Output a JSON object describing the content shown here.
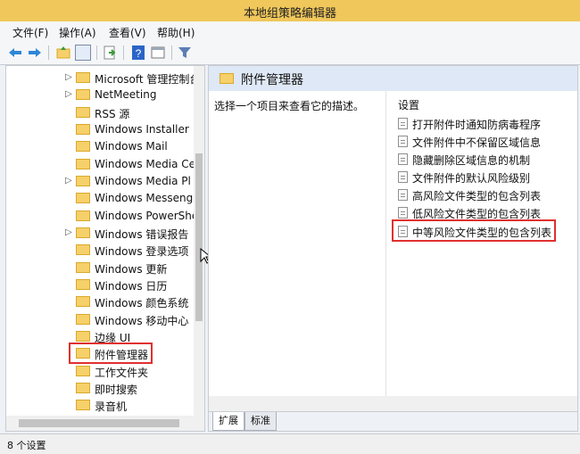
{
  "window": {
    "title": "本地组策略编辑器"
  },
  "menu": [
    "文件(F)",
    "操作(A)",
    "查看(V)",
    "帮助(H)"
  ],
  "toolbar_icons": [
    "back-arrow-icon",
    "forward-arrow-icon",
    "up-folder-icon",
    "show-tree-icon",
    "export-icon",
    "help-icon",
    "properties-icon",
    "filter-icon"
  ],
  "tree": {
    "items": [
      {
        "label": "Microsoft 管理控制台",
        "expander": "▷"
      },
      {
        "label": "NetMeeting",
        "expander": "▷"
      },
      {
        "label": "RSS 源",
        "expander": ""
      },
      {
        "label": "Windows Installer",
        "expander": ""
      },
      {
        "label": "Windows Mail",
        "expander": ""
      },
      {
        "label": "Windows Media Ce",
        "expander": ""
      },
      {
        "label": "Windows Media Pl",
        "expander": "▷"
      },
      {
        "label": "Windows Messeng",
        "expander": ""
      },
      {
        "label": "Windows PowerShe",
        "expander": ""
      },
      {
        "label": "Windows 错误报告",
        "expander": "▷"
      },
      {
        "label": "Windows 登录选项",
        "expander": ""
      },
      {
        "label": "Windows 更新",
        "expander": ""
      },
      {
        "label": "Windows 日历",
        "expander": ""
      },
      {
        "label": "Windows 颜色系统",
        "expander": ""
      },
      {
        "label": "Windows 移动中心",
        "expander": ""
      },
      {
        "label": "边缘 UI",
        "expander": ""
      },
      {
        "label": "附件管理器",
        "expander": ""
      },
      {
        "label": "工作文件夹",
        "expander": ""
      },
      {
        "label": "即时搜索",
        "expander": ""
      },
      {
        "label": "录音机",
        "expander": ""
      }
    ],
    "selected_index": 16
  },
  "right": {
    "header_title": "附件管理器",
    "description": "选择一个项目来查看它的描述。",
    "settings_header": "设置",
    "settings": [
      "打开附件时通知防病毒程序",
      "文件附件中不保留区域信息",
      "隐藏删除区域信息的机制",
      "文件附件的默认风险级别",
      "高风险文件类型的包含列表",
      "低风险文件类型的包含列表",
      "中等风险文件类型的包含列表"
    ],
    "highlighted_setting_index": 6,
    "tabs": [
      "扩展",
      "标准"
    ]
  },
  "status": {
    "text": "8 个设置"
  },
  "colors": {
    "title_bar": "#f0c75a",
    "highlight_border": "#e03030",
    "pane_header": "#dfe8f6"
  }
}
